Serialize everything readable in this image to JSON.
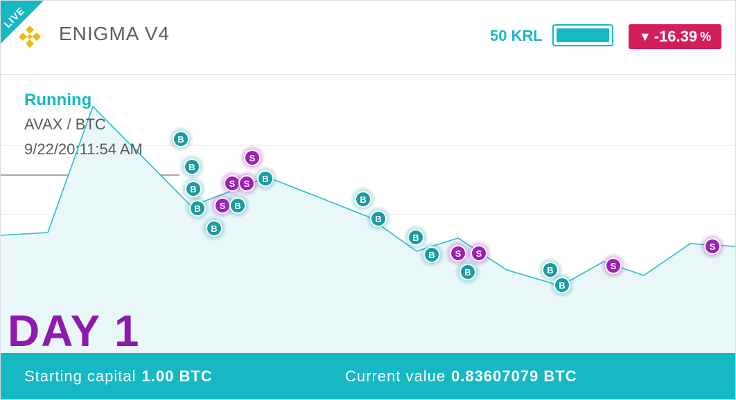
{
  "header": {
    "live_badge": "LIVE",
    "title": "ENIGMA V4",
    "krl_label": "50 KRL",
    "krl_level": 1.0,
    "change_arrow": "▼",
    "change_value": "-16.39",
    "change_unit": "%",
    "logo_icon": "binance-logo-icon"
  },
  "info": {
    "status": "Running",
    "pair": "AVAX / BTC",
    "timestamp": "9/22/20:11:54 AM"
  },
  "day_label": "DAY 1",
  "footer": {
    "starting_label": "Starting capital",
    "starting_value": "1.00 BTC",
    "current_label": "Current value",
    "current_value": "0.83607079 BTC"
  },
  "colors": {
    "accent": "#16b9c3",
    "buy": "#1b9aa1",
    "sell": "#9d1fb5",
    "negative": "#d41e5a",
    "day": "#8d1aae"
  },
  "markers": {
    "buy_letter": "B",
    "sell_letter": "S"
  }
}
